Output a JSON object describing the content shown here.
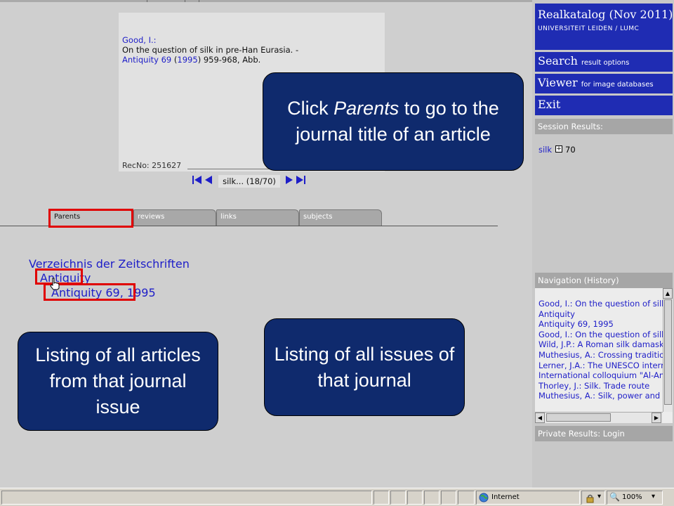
{
  "record": {
    "author": "Good, I.:",
    "title": "On the question of silk in pre-Han Eurasia. -",
    "journal_link": "Antiquity 69",
    "year_open": " (",
    "year_link": "1995",
    "pages": ") 959-968, Abb.",
    "recno": "RecNo: 251627"
  },
  "pager": {
    "first_icon": "first-record-icon",
    "prev_icon": "previous-record-icon",
    "counter": "silk... (18/70)",
    "next_icon": "next-record-icon",
    "last_icon": "last-record-icon"
  },
  "tabs": [
    {
      "label": "Parents",
      "active": true
    },
    {
      "label": "reviews",
      "active": false
    },
    {
      "label": "links",
      "active": false
    },
    {
      "label": "subjects",
      "active": false
    }
  ],
  "tree": {
    "root": "Verzeichnis der Zeitschriften",
    "journal": "Antiquity",
    "issue": "Antiquity 69, 1995"
  },
  "callouts": {
    "parents_pre": "Click ",
    "parents_em": "Parents",
    "parents_post": " to go to the journal title of an article",
    "issues": "Listing of all issues of that journal",
    "articles": "Listing of all articles from that journal issue"
  },
  "sidebar": {
    "catalog_title": "Realkatalog (Nov 2011)",
    "catalog_subtitle": "UNIVERSITEIT LEIDEN / LUMC",
    "search_label": "Search",
    "search_sub": "result options",
    "viewer_label": "Viewer",
    "viewer_sub": "for image databases",
    "exit_label": "Exit",
    "session_header": "Session Results:",
    "session_term": "silk",
    "session_count": "70",
    "history_header": "Navigation (History)",
    "history": [
      "Good, I.: On the question of silk in pre-Han Eurasia",
      "Antiquity",
      "Antiquity 69, 1995",
      "Good, I.: On the question of silk in pre-Han Eurasia",
      "Wild, J.P.: A Roman silk damask",
      "Muthesius, A.: Crossing traditions",
      "Lerner, J.A.: The UNESCO international",
      "International colloquium \"Al-Andalus",
      "Thorley, J.: Silk. Trade route",
      "Muthesius, A.: Silk, power and diplomacy"
    ],
    "private_header": "Private Results: Login"
  },
  "statusbar": {
    "zone": "Internet",
    "zoom": "100%"
  },
  "colors": {
    "link": "#1d1dc8",
    "callout_bg": "#0f2a6d",
    "sidebar_button": "#1f2cb3",
    "highlight_border": "#e00000"
  }
}
